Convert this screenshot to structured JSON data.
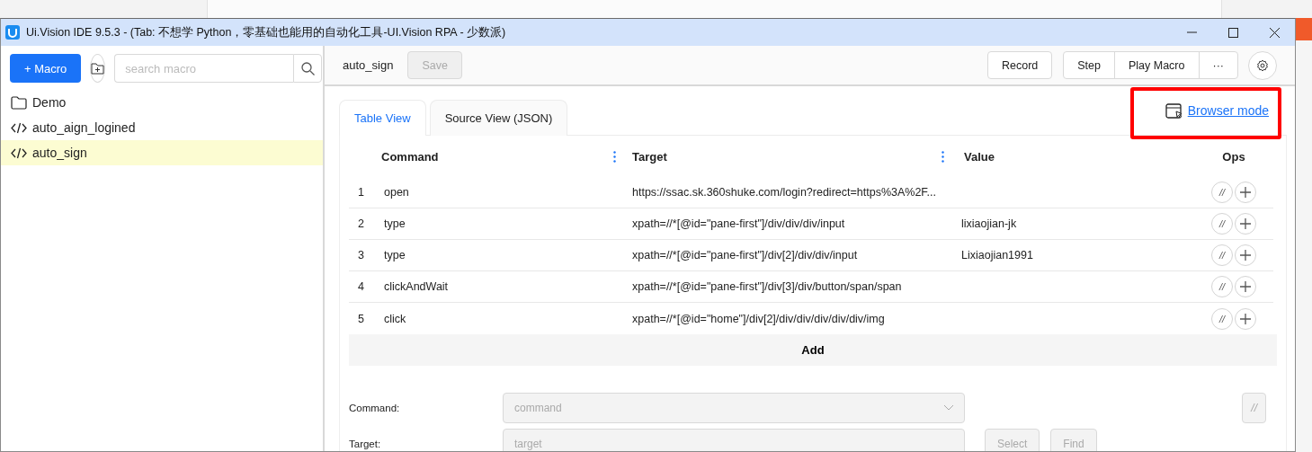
{
  "window": {
    "title": "Ui.Vision IDE 9.5.3 - (Tab: 不想学 Python，零基础也能用的自动化工具-UI.Vision RPA - 少数派)"
  },
  "sidebar": {
    "new_macro_button": "+ Macro",
    "search": {
      "placeholder": "search macro"
    },
    "items": [
      {
        "kind": "folder",
        "label": "Demo",
        "selected": false
      },
      {
        "kind": "macro",
        "label": "auto_aign_logined",
        "selected": false
      },
      {
        "kind": "macro",
        "label": "auto_sign",
        "selected": true
      }
    ]
  },
  "toolbar": {
    "macro_name": "auto_sign",
    "save_button": {
      "label": "Save",
      "disabled": true
    },
    "record_button": "Record",
    "step_button": "Step",
    "play_button": "Play Macro",
    "more_button": "···"
  },
  "editor": {
    "tabs": [
      {
        "label": "Table View",
        "selected": true
      },
      {
        "label": "Source View (JSON)",
        "selected": false
      }
    ],
    "browser_mode": {
      "label": "Browser mode",
      "highlighted": true
    },
    "table": {
      "columns": [
        "Command",
        "Target",
        "Value",
        "Ops"
      ],
      "rows": [
        {
          "index": "1",
          "command": "open",
          "target": "https://ssac.sk.360shuke.com/login?redirect=https%3A%2F...",
          "comment_button": "//"
        },
        {
          "index": "2",
          "command": "type",
          "target": "xpath=//*[@id=\"pane-first\"]/div/div/div/input",
          "value": "lixiaojian-jk",
          "comment_button": "//"
        },
        {
          "index": "3",
          "command": "type",
          "target": "xpath=//*[@id=\"pane-first\"]/div[2]/div/div/input",
          "value": "Lixiaojian1991",
          "comment_button": "//"
        },
        {
          "index": "4",
          "command": "clickAndWait",
          "target": "xpath=//*[@id=\"pane-first\"]/div[3]/div/button/span/span",
          "comment_button": "//"
        },
        {
          "index": "5",
          "command": "click",
          "target": "xpath=//*[@id=\"home\"]/div[2]/div/div/div/div/div/img",
          "comment_button": "//"
        }
      ],
      "add_button": "Add"
    },
    "form": {
      "fields": [
        {
          "kind": "select",
          "label": "Command:",
          "placeholder": "command",
          "disabled": true,
          "buttons": [
            "//"
          ]
        },
        {
          "kind": "text",
          "label": "Target:",
          "placeholder": "target",
          "disabled": true,
          "buttons": [
            "Select",
            "Find"
          ]
        }
      ]
    }
  }
}
